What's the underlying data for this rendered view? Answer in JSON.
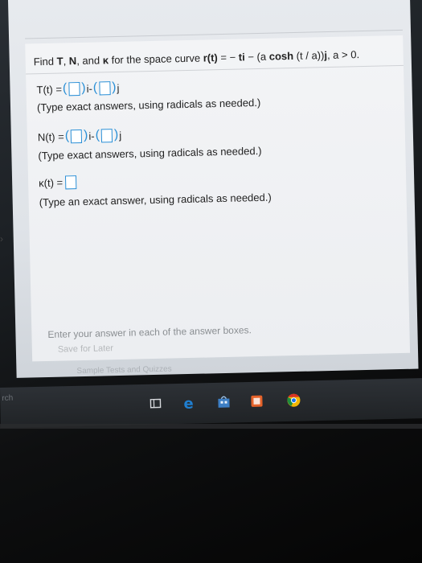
{
  "question": {
    "prefix": "Find ",
    "T": "T",
    "sep1": ", ",
    "N": "N",
    "sep2": ", and ",
    "kappa": "κ",
    "mid": " for the space curve ",
    "rt": "r(t)",
    "eq": " = − ",
    "ti": "ti",
    "minus": " − (a ",
    "cosh": "cosh",
    "tail": " (t / a))",
    "j": "j",
    "cond": ", a > 0."
  },
  "tangent": {
    "label": "T(t) =",
    "i": "i",
    "op": " - ",
    "j": "j",
    "hint": "(Type exact answers, using radicals as needed.)"
  },
  "normal": {
    "label": "N(t) =",
    "i": "i",
    "op": " - ",
    "j": "j",
    "hint": "(Type exact answers, using radicals as needed.)"
  },
  "curvature": {
    "label": "κ(t) =",
    "hint": "(Type an exact answer, using radicals as needed.)"
  },
  "footer": {
    "instruction": "Enter your answer in each of the answer boxes.",
    "save": "Save for Later",
    "blurred": "Sample Tests and Quizzes"
  },
  "taskbar": {
    "left_text": "rch",
    "icons": [
      "task-view-icon",
      "edge-icon",
      "store-icon",
      "office-icon",
      "chrome-icon"
    ]
  },
  "colors": {
    "answer_box": "#2a8fd6",
    "edge": "#1f7fd1",
    "store": "#3d7fc5",
    "office": "#e5622a",
    "chrome": "#f2b705"
  }
}
